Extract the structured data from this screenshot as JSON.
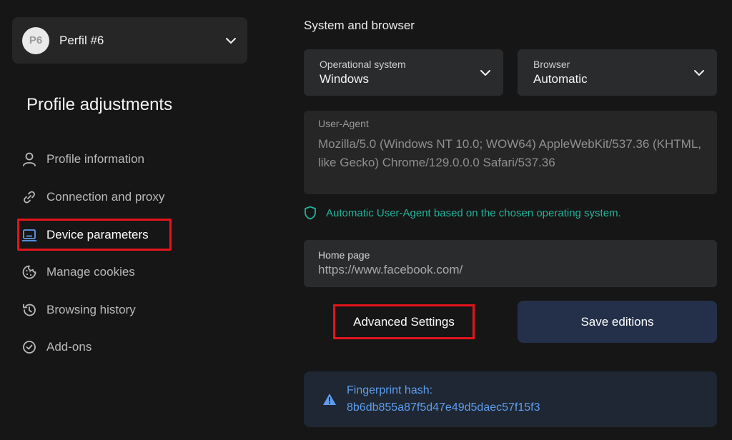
{
  "profile": {
    "avatar_text": "P6",
    "name": "Perfil #6"
  },
  "sidebar": {
    "title": "Profile adjustments",
    "items": [
      {
        "label": "Profile information",
        "icon": "user-icon"
      },
      {
        "label": "Connection and proxy",
        "icon": "link-icon"
      },
      {
        "label": "Device parameters",
        "icon": "laptop-icon",
        "active": true
      },
      {
        "label": "Manage cookies",
        "icon": "cookie-icon"
      },
      {
        "label": "Browsing history",
        "icon": "history-icon"
      },
      {
        "label": "Add-ons",
        "icon": "check-circle-icon"
      }
    ]
  },
  "system": {
    "title": "System and browser",
    "os": {
      "label": "Operational system",
      "value": "Windows"
    },
    "browser": {
      "label": "Browser",
      "value": "Automatic"
    },
    "user_agent": {
      "label": "User-Agent",
      "value": "Mozilla/5.0 (Windows NT 10.0; WOW64) AppleWebKit/537.36 (KHTML, like Gecko) Chrome/129.0.0.0 Safari/537.36"
    },
    "ua_hint": "Automatic User-Agent based on the chosen operating system.",
    "home_page": {
      "label": "Home page",
      "value": "https://www.facebook.com/"
    }
  },
  "actions": {
    "advanced_label": "Advanced Settings",
    "save_label": "Save editions"
  },
  "fingerprint": {
    "title": "Fingerprint hash:",
    "value": "8b6db855a87f5d47e49d5daec57f15f3"
  },
  "colors": {
    "accent_green": "#21b39a",
    "accent_blue": "#5f9cec",
    "highlight_red": "#e3141b",
    "save_button_bg": "#243049"
  }
}
